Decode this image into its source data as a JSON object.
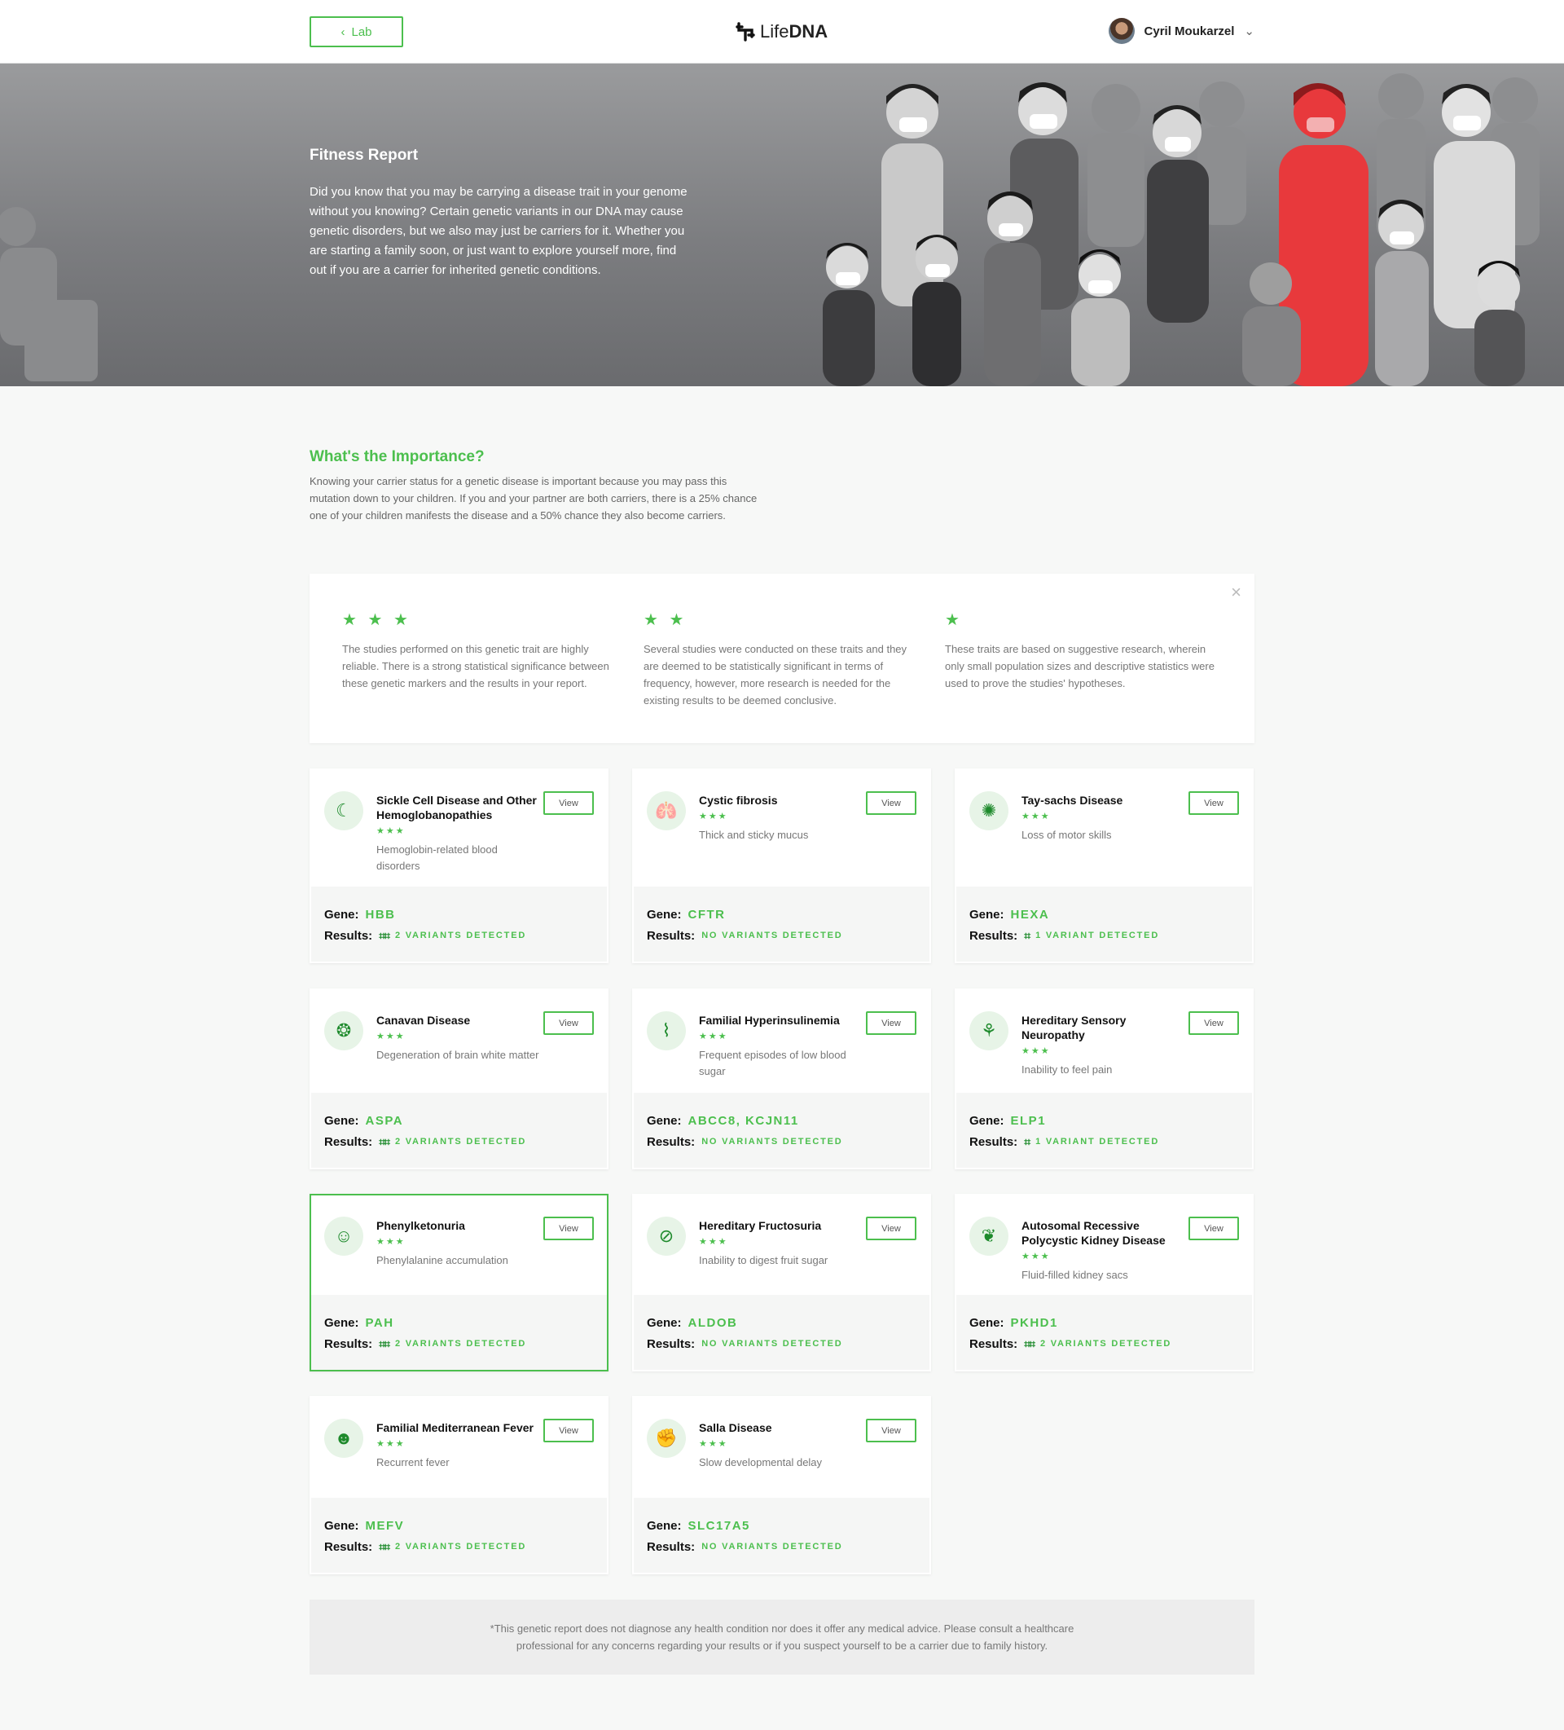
{
  "header": {
    "back_label": "Lab",
    "logo_text_light": "Life",
    "logo_text_bold": "DNA",
    "user_name": "Cyril Moukarzel"
  },
  "hero": {
    "title": "Fitness Report",
    "description": "Did you know that you may be carrying a disease trait in your genome without you knowing? Certain genetic variants in our DNA may cause genetic disorders, but we also may just be carriers for it. Whether you are starting a family soon, or just want to explore yourself more, find out if you are a carrier for inherited genetic conditions."
  },
  "importance": {
    "title": "What's the Importance?",
    "text": "Knowing your carrier status for a genetic disease is important because you may pass this mutation down to your children. If you and your partner are both carriers, there is a 25% chance one of your children manifests the disease and a 50% chance they also become carriers."
  },
  "legend": {
    "items": [
      {
        "stars": "★ ★ ★",
        "text": "The studies performed on this genetic trait are highly reliable. There is a strong statistical significance between these genetic markers and the results in your report."
      },
      {
        "stars": "★ ★",
        "text": "Several studies were conducted on these traits and they are deemed to be statistically significant in terms of frequency, however, more research is needed for the existing results to be deemed conclusive."
      },
      {
        "stars": "★",
        "text": "These traits are based on suggestive research, wherein only small population sizes and descriptive statistics were used to prove the studies' hypotheses."
      }
    ]
  },
  "labels": {
    "view": "View",
    "gene": "Gene:",
    "results": "Results:"
  },
  "cards": [
    {
      "title": "Sickle Cell Disease and Other Hemoglobanopathies",
      "stars": "★★★",
      "desc": "Hemoglobin-related blood disorders",
      "gene": "HBB",
      "result": "2 VARIANTS DETECTED",
      "variants": 2,
      "icon": "crescent-icon"
    },
    {
      "title": "Cystic fibrosis",
      "stars": "★★★",
      "desc": "Thick and sticky mucus",
      "gene": "CFTR",
      "result": "NO VARIANTS DETECTED",
      "variants": 0,
      "icon": "lungs-icon"
    },
    {
      "title": "Tay-sachs Disease",
      "stars": "★★★",
      "desc": "Loss of motor skills",
      "gene": "HEXA",
      "result": "1 VARIANT DETECTED",
      "variants": 1,
      "icon": "neuron-icon"
    },
    {
      "title": "Canavan Disease",
      "stars": "★★★",
      "desc": "Degeneration of brain white matter",
      "gene": "ASPA",
      "result": "2 VARIANTS DETECTED",
      "variants": 2,
      "icon": "brain-icon"
    },
    {
      "title": "Familial Hyperinsulinemia",
      "stars": "★★★",
      "desc": "Frequent episodes of low blood sugar",
      "gene": "ABCC8, KCJN11",
      "result": "NO VARIANTS DETECTED",
      "variants": 0,
      "icon": "pancreas-icon"
    },
    {
      "title": "Hereditary Sensory Neuropathy",
      "stars": "★★★",
      "desc": "Inability to feel pain",
      "gene": "ELP1",
      "result": "1 VARIANT DETECTED",
      "variants": 1,
      "icon": "nerve-icon"
    },
    {
      "title": "Phenylketonuria",
      "stars": "★★★",
      "desc": "Phenylalanine accumulation",
      "gene": "PAH",
      "result": "2 VARIANTS DETECTED",
      "variants": 2,
      "icon": "person-icon"
    },
    {
      "title": "Hereditary Fructosuria",
      "stars": "★★★",
      "desc": "Inability to digest fruit sugar",
      "gene": "ALDOB",
      "result": "NO VARIANTS DETECTED",
      "variants": 0,
      "icon": "no-fruit-icon"
    },
    {
      "title": "Autosomal Recessive Polycystic Kidney Disease",
      "stars": "★★★",
      "desc": "Fluid-filled kidney sacs",
      "gene": "PKHD1",
      "result": "2 VARIANTS DETECTED",
      "variants": 2,
      "icon": "kidneys-icon"
    },
    {
      "title": "Familial Mediterranean Fever",
      "stars": "★★★",
      "desc": "Recurrent fever",
      "gene": "MEFV",
      "result": "2 VARIANTS DETECTED",
      "variants": 2,
      "icon": "fever-icon"
    },
    {
      "title": "Salla Disease",
      "stars": "★★★",
      "desc": "Slow developmental delay",
      "gene": "SLC17A5",
      "result": "NO VARIANTS DETECTED",
      "variants": 0,
      "icon": "muscle-icon"
    }
  ],
  "disclaimer": "*This genetic report does not diagnose any health condition nor does it offer any medical advice. Please consult a healthcare professional for any concerns regarding your results or if you suspect yourself to be a carrier due to family history.",
  "colors": {
    "accent": "#4cbf4e",
    "accent_dark": "#1e8a2c",
    "highlight": "#e8393c"
  }
}
